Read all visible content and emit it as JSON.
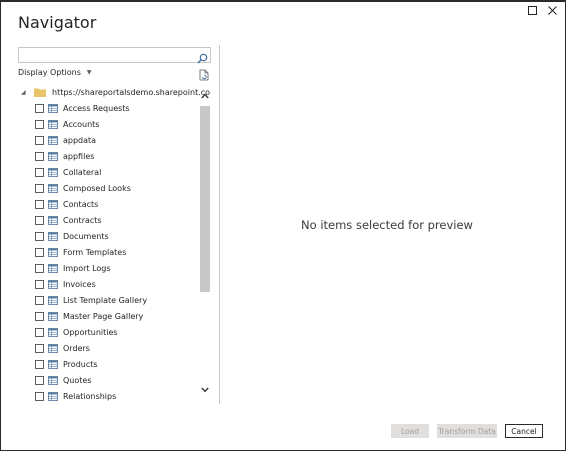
{
  "window": {
    "title": "Navigator",
    "maximize_icon": "maximize-icon",
    "close_icon": "close-icon"
  },
  "search": {
    "value": "",
    "placeholder": "",
    "icon": "search-icon"
  },
  "display_options": {
    "label": "Display Options",
    "refresh_icon": "refresh-icon"
  },
  "tree": {
    "root_label": "https://shareportalsdemo.sharepoint.com/s...",
    "root_icon": "folder-icon",
    "items": [
      {
        "label": "Access Requests"
      },
      {
        "label": "Accounts"
      },
      {
        "label": "appdata"
      },
      {
        "label": "appfiles"
      },
      {
        "label": "Collateral"
      },
      {
        "label": "Composed Looks"
      },
      {
        "label": "Contacts"
      },
      {
        "label": "Contracts"
      },
      {
        "label": "Documents"
      },
      {
        "label": "Form Templates"
      },
      {
        "label": "Import Logs"
      },
      {
        "label": "Invoices"
      },
      {
        "label": "List Template Gallery"
      },
      {
        "label": "Master Page Gallery"
      },
      {
        "label": "Opportunities"
      },
      {
        "label": "Orders"
      },
      {
        "label": "Products"
      },
      {
        "label": "Quotes"
      },
      {
        "label": "Relationships"
      }
    ]
  },
  "preview": {
    "message": "No items selected for preview"
  },
  "footer": {
    "load_label": "Load",
    "transform_label": "Transform Data",
    "cancel_label": "Cancel"
  },
  "colors": {
    "folder": "#e8c36a",
    "table_icon": "#5b7ea6",
    "disabled_button": "#e1dfdd"
  }
}
